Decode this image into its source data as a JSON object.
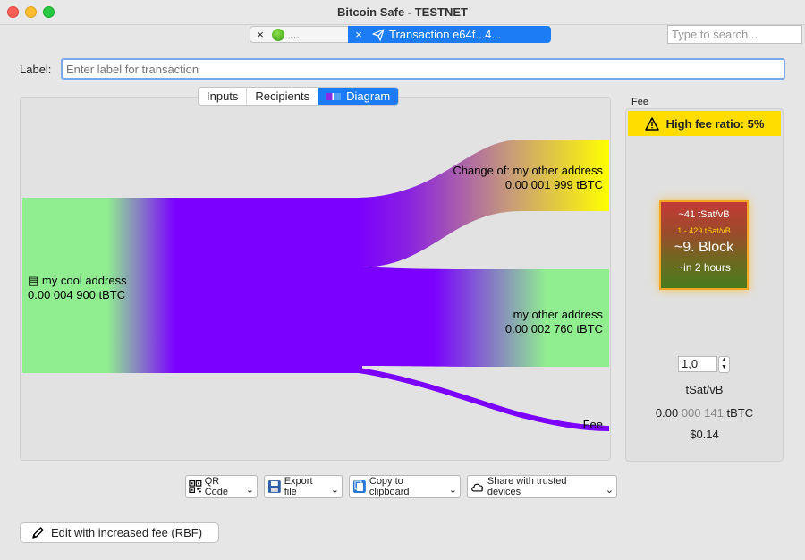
{
  "window": {
    "title": "Bitcoin Safe - TESTNET",
    "tabs": [
      {
        "label": "...",
        "close": "×",
        "active": false
      },
      {
        "label": "Transaction e64f...4...",
        "close": "×",
        "active": true
      }
    ],
    "search_placeholder": "Type to search..."
  },
  "label_field": {
    "label": "Label:",
    "placeholder": "Enter label for transaction",
    "value": ""
  },
  "view_tabs": [
    "Inputs",
    "Recipients",
    "Diagram"
  ],
  "active_view": "Diagram",
  "diagram": {
    "input": {
      "name": "my cool address",
      "amount": "0.00 004 900 tBTC"
    },
    "outputs": [
      {
        "name": "Change of: my other address",
        "amount": "0.00 001 999 tBTC"
      },
      {
        "name": "my other address",
        "amount": "0.00 002 760 tBTC"
      },
      {
        "name": "Fee",
        "amount": ""
      }
    ],
    "colors": {
      "input": "#90ee90",
      "flow": "#7b00ff",
      "change": "#ffff00",
      "recipient": "#90ee90",
      "fee": "#7b00ff"
    }
  },
  "fee": {
    "title": "Fee",
    "warning": "High fee ratio: 5%",
    "block": {
      "rate": "~41 tSat/vB",
      "range": "1 - 429 tSat/vB",
      "position": "~9. Block",
      "eta": "~in 2 hours"
    },
    "rate_value": "1,0",
    "unit": "tSat/vB",
    "btc_parts": {
      "a": "0.00",
      "b": "000",
      "c": "141",
      "d": "tBTC"
    },
    "usd": "$0.14"
  },
  "toolbar": {
    "qr": "QR Code",
    "export": "Export file",
    "copy": "Copy to clipboard",
    "share": "Share with trusted devices"
  },
  "rbf_button": "Edit with increased fee (RBF)"
}
